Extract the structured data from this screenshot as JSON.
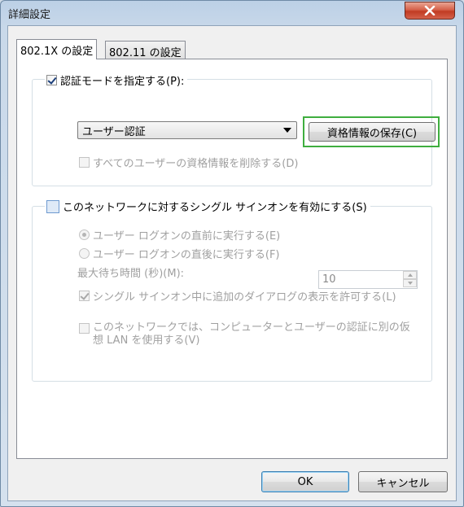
{
  "window": {
    "title": "詳細設定",
    "close_symbol": "✕"
  },
  "tabs": [
    {
      "label": "802.1X の設定",
      "active": true
    },
    {
      "label": "802.11 の設定",
      "active": false
    }
  ],
  "auth_group": {
    "specify_mode_label": "認証モードを指定する(P):",
    "specify_mode_checked": true,
    "auth_mode_selected": "ユーザー認証",
    "save_credentials_button": "資格情報の保存(C)",
    "delete_credentials_label": "すべてのユーザーの資格情報を削除する(D)",
    "delete_credentials_checked": false
  },
  "sso_group": {
    "enable_sso_label": "このネットワークに対するシングル サインオンを有効にする(S)",
    "enable_sso_checked": false,
    "before_logon_label": "ユーザー ログオンの直前に実行する(E)",
    "after_logon_label": "ユーザー ログオンの直後に実行する(F)",
    "max_wait_label": "最大待ち時間 (秒)(M):",
    "max_wait_value": "10",
    "allow_dialogs_label": "シングル サインオン中に追加のダイアログの表示を許可する(L)",
    "allow_dialogs_checked": true,
    "separate_vlan_label_line1": "このネットワークでは、コンピューターとユーザーの認証に別の仮",
    "separate_vlan_label_line2": "想 LAN を使用する(V)",
    "separate_vlan_checked": false
  },
  "footer": {
    "ok_button": "OK",
    "cancel_button": "キャンセル"
  },
  "colors": {
    "highlight": "#3fae3f",
    "close_button": "#c13b22"
  }
}
